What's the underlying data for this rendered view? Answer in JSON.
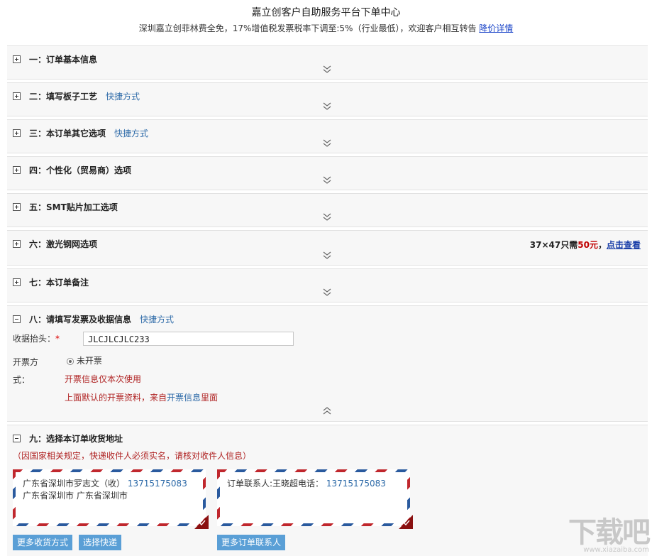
{
  "header": {
    "title": "嘉立创客户自助服务平台下单中心",
    "notice": "深圳嘉立创菲林费全免，17%增值税发票税率下调至:5%（行业最低），欢迎客户相互转告",
    "notice_link": "降价详情"
  },
  "sections": [
    {
      "title": "一：订单基本信息",
      "quick": ""
    },
    {
      "title": "二：填写板子工艺",
      "quick": "快捷方式"
    },
    {
      "title": "三：本订单其它选项",
      "quick": "快捷方式"
    },
    {
      "title": "四：个性化（贸易商）选项",
      "quick": ""
    },
    {
      "title": "五：SMT贴片加工选项",
      "quick": ""
    },
    {
      "title": "六：激光钢网选项",
      "quick": "",
      "note_prefix": "37×47只需",
      "note_price": "50元",
      "note_sep": "，",
      "note_link": "点击查看"
    },
    {
      "title": "七：本订单备注",
      "quick": ""
    },
    {
      "title": "八：请填写发票及收据信息",
      "quick": "快捷方式"
    },
    {
      "title": "九：选择本订单收货地址",
      "quick": ""
    }
  ],
  "invoice": {
    "receipt_label": "收据抬头：",
    "required_mark": "*",
    "receipt_value": "JLCJLCJLC233",
    "type_label_1": "开票方",
    "type_label_2": "式：",
    "type_option": "未开票",
    "hint_1": "开票信息仅本次使用",
    "hint_2_prefix": "上面默认的开票资料，来自",
    "hint_2_link": "开票信息",
    "hint_2_suffix": "里面"
  },
  "address": {
    "warning": "（因国家相关规定，快递收件人必须实名，请核对收件人信息）",
    "card1_line1": "广东省深圳市罗志文（收）",
    "card1_phone": "13715175083",
    "card1_line2": "广东省深圳市 广东省深圳市",
    "card2_line1": "订单联系人:王晓超电话：",
    "card2_phone": "13715175083",
    "btn_more_delivery": "更多收货方式",
    "btn_choose_express": "选择快递",
    "btn_more_contacts": "更多订单联系人"
  },
  "watermark": {
    "text": "下载吧",
    "sub": "www.xiazaiba.com"
  },
  "icons": {
    "expand": "plus-square-icon",
    "collapse": "minus-square-icon",
    "chevron_down": "double-chevron-down-icon",
    "chevron_up": "double-chevron-up-icon",
    "check": "check-icon"
  },
  "colors": {
    "link_blue": "#2d6aa8",
    "red": "#b02424",
    "button_blue": "#5a9fd6"
  }
}
